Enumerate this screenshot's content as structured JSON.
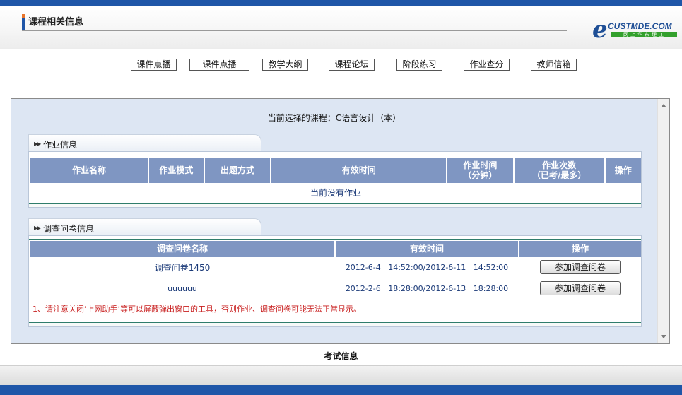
{
  "header": {
    "title": "课程相关信息",
    "logo": {
      "text": "CUSTMDE.COM",
      "sub": "网上华东理工"
    }
  },
  "nav": [
    {
      "label": "课件点播"
    },
    {
      "label": "课件点播"
    },
    {
      "label": "教学大纲"
    },
    {
      "label": "课程论坛"
    },
    {
      "label": "阶段练习"
    },
    {
      "label": "作业查分"
    },
    {
      "label": "教师信箱"
    }
  ],
  "course": {
    "text": "当前选择的课程：C语言设计（本）"
  },
  "homework": {
    "tab_label": "作业信息",
    "columns": [
      "作业名称",
      "作业模式",
      "出题方式",
      "有效时间",
      "作业时间\n（分钟）",
      "作业次数\n（已考/最多）",
      "操作"
    ],
    "columns_line1": [
      "作业名称",
      "作业模式",
      "出题方式",
      "有效时间",
      "作业时间",
      "作业次数",
      "操作"
    ],
    "columns_line2": [
      "",
      "",
      "",
      "",
      "（分钟）",
      "（已考/最多）",
      ""
    ],
    "empty_text": "当前没有作业"
  },
  "survey": {
    "tab_label": "调查问卷信息",
    "columns": [
      "调查问卷名称",
      "有效时间",
      "操作"
    ],
    "rows": [
      {
        "name": "调查问卷1450",
        "time": "2012-6-4   14:52:00/2012-6-11   14:52:00",
        "action": "参加调查问卷"
      },
      {
        "name": "uuuuuu",
        "time": "2012-2-6   18:28:00/2012-6-13   18:28:00",
        "action": "参加调查问卷"
      }
    ],
    "notice": "1、请注意关闭‘上网助手’等可以屏蔽弹出窗口的工具，否则作业、调查问卷可能无法正常显示。"
  },
  "footer": {
    "exam_label": "考试信息"
  }
}
